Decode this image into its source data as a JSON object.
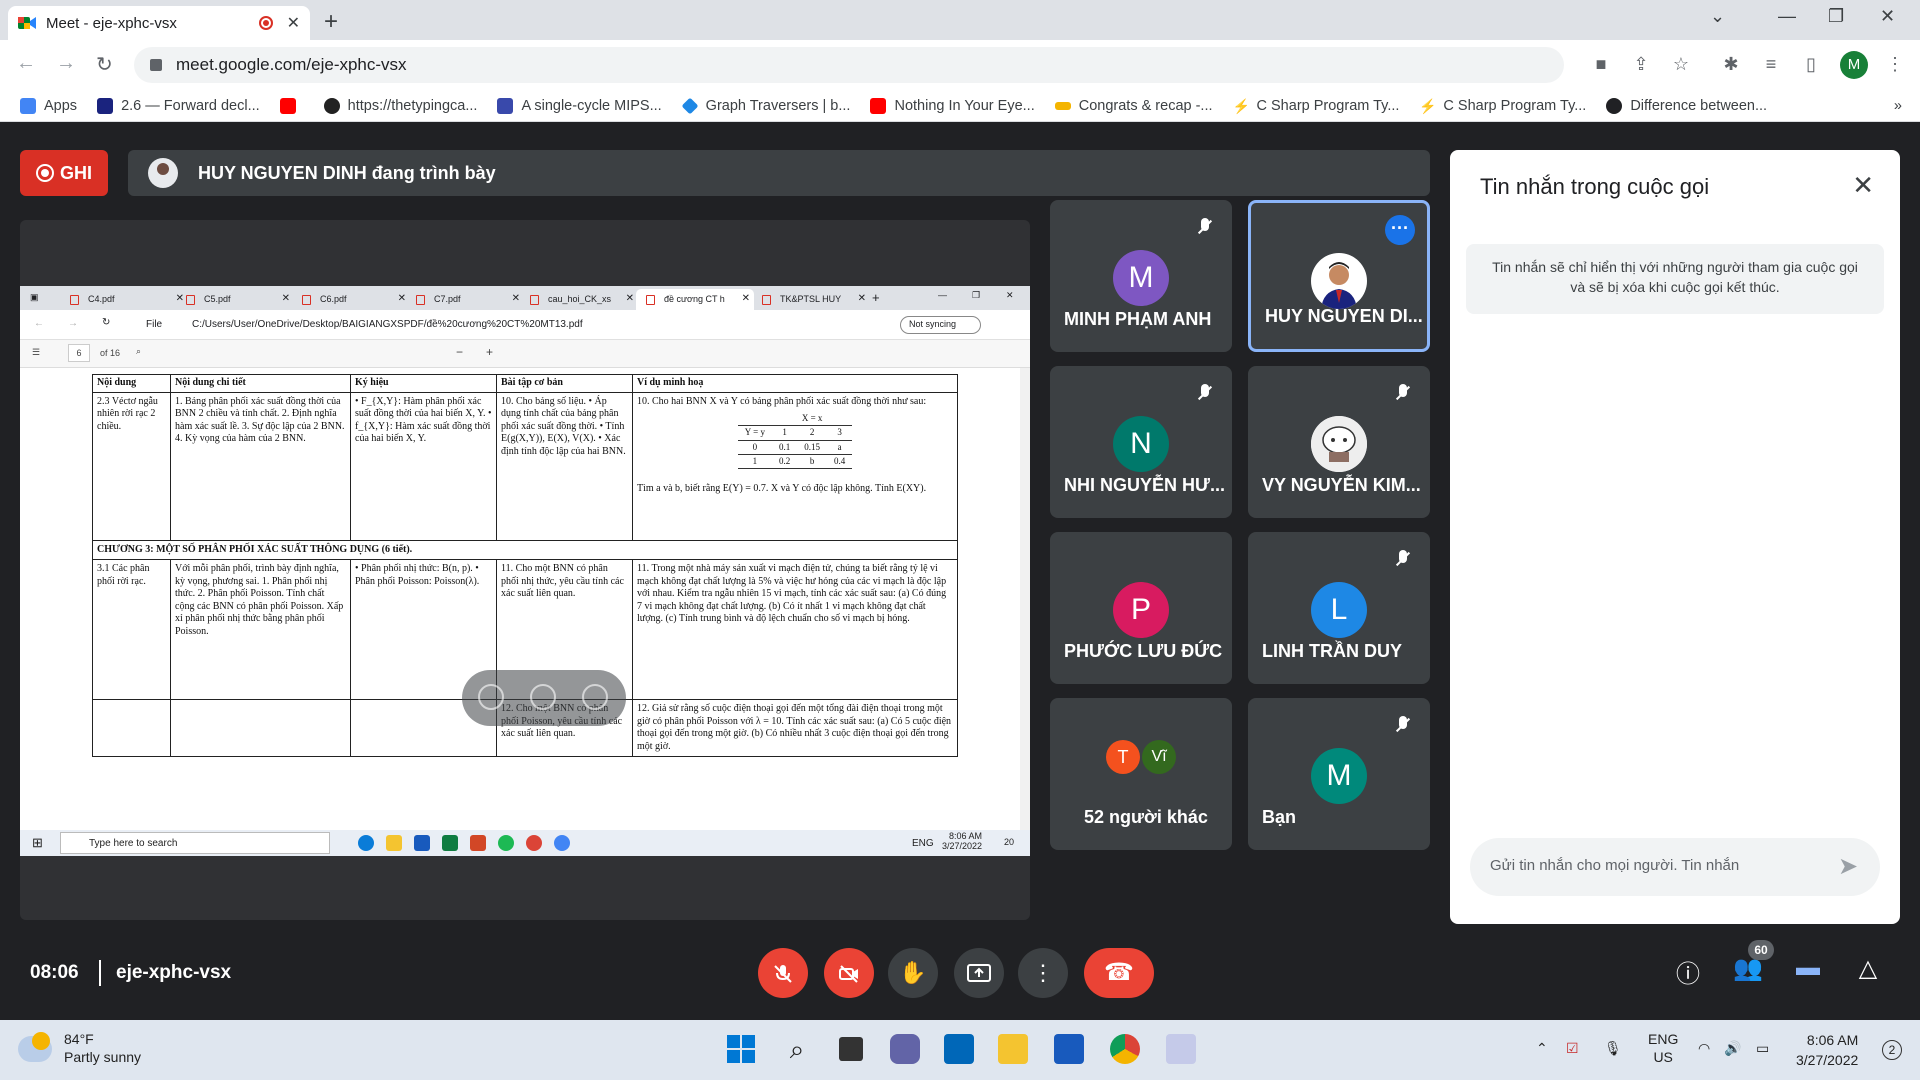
{
  "browser": {
    "tab_title": "Meet - eje-xphc-vsx",
    "url": "meet.google.com/eje-xphc-vsx",
    "profile_letter": "M",
    "bookmarks": [
      {
        "label": "Apps",
        "color": "#4285f4"
      },
      {
        "label": "2.6 — Forward decl...",
        "color": "#1a237e"
      },
      {
        "label": "",
        "color": "#ff0000"
      },
      {
        "label": "https://thetypingca...",
        "color": "#222222"
      },
      {
        "label": "A single-cycle MIPS...",
        "color": "#3949ab"
      },
      {
        "label": "Graph Traversers | b...",
        "color": "#1e88e5"
      },
      {
        "label": "Nothing In Your Eye...",
        "color": "#ff0000"
      },
      {
        "label": "Congrats & recap -...",
        "color": "#f4b400"
      },
      {
        "label": "C Sharp Program Ty...",
        "color": "#333333"
      },
      {
        "label": "C Sharp Program Ty...",
        "color": "#333333"
      },
      {
        "label": "Difference between...",
        "color": "#202124"
      }
    ]
  },
  "meet": {
    "record_label": "GHI",
    "presenting_text": "HUY NGUYEN DINH đang trình bày",
    "participants": [
      {
        "name": "MINH PHẠM ANH",
        "initial": "M",
        "color": "#7e57c2"
      },
      {
        "name": "HUY NGUYEN DI...",
        "initial": "",
        "color": "#ffffff"
      },
      {
        "name": "NHI NGUYỄN HƯ...",
        "initial": "N",
        "color": "#00796b"
      },
      {
        "name": "VY NGUYỄN KIM...",
        "initial": "",
        "color": "#fafafa"
      },
      {
        "name": "PHƯỚC LƯU ĐỨC",
        "initial": "P",
        "color": "#d81b60"
      },
      {
        "name": "LINH TRẦN DUY",
        "initial": "L",
        "color": "#1e88e5"
      },
      {
        "name": "52 người khác",
        "initial": "T",
        "initial2": "Vĩ",
        "color": "#f4511e",
        "color2": "#33691e"
      },
      {
        "name": "Bạn",
        "initial": "M",
        "color": "#00897b"
      }
    ],
    "chat": {
      "title": "Tin nhắn trong cuộc gọi",
      "note": "Tin nhắn sẽ chỉ hiển thị với những người tham gia cuộc gọi và sẽ bị xóa khi cuộc gọi kết thúc.",
      "placeholder": "Gửi tin nhắn cho mọi người. Tin nhắn"
    },
    "time": "08:06",
    "code": "eje-xphc-vsx",
    "participant_count": "60"
  },
  "shared_screen": {
    "tabs": [
      "C4.pdf",
      "C5.pdf",
      "C6.pdf",
      "C7.pdf",
      "cau_hoi_CK_xs",
      "đề cương CT h",
      "TK&PTSL HUY"
    ],
    "file_label": "File",
    "path": "C:/Users/User/OneDrive/Desktop/BAIGIANGXSPDF/đề%20cương%20CT%20MT13.pdf",
    "sync_label": "Not syncing",
    "page_num": "6",
    "page_total": "of 16",
    "table_headers": [
      "Nội dung",
      "Nội dung chi tiết",
      "Ký hiệu",
      "Bài tập cơ bản",
      "Ví dụ minh hoạ"
    ],
    "row1": {
      "c1": "2.3 Véctơ ngẫu nhiên rời rạc 2 chiều.",
      "c2": "1. Bảng phân phối xác suất đồng thời của BNN 2 chiều và tính chất. 2. Định nghĩa hàm xác suất lề. 3. Sự độc lập của 2 BNN. 4. Kỳ vọng của hàm của 2 BNN.",
      "c3": "• F_{X,Y}: Hàm phân phối xác suất đồng thời của hai biến X, Y. • f_{X,Y}: Hàm xác suất đồng thời của hai biến X, Y.",
      "c4": "10. Cho bảng số liệu. • Áp dụng tính chất của bảng phân phối xác suất đồng thời. • Tính E(g(X,Y)), E(X), V(X). • Xác định tính độc lập của hai BNN.",
      "c5": "10. Cho hai BNN X và Y có bảng phân phối xác suất đồng thời như sau:",
      "c5b": "Tìm a và b, biết rằng E(Y) = 0.7. X và Y có độc lập không. Tính E(XY)."
    },
    "mini_table": {
      "header": "X = x",
      "row0": [
        "Y = y",
        "1",
        "2",
        "3"
      ],
      "row1": [
        "0",
        "0.1",
        "0.15",
        "a"
      ],
      "row2": [
        "1",
        "0.2",
        "b",
        "0.4"
      ]
    },
    "chapter": "CHƯƠNG 3: MỘT SỐ PHÂN PHỐI XÁC SUẤT THÔNG DỤNG (6 tiết).",
    "row2": {
      "c1": "3.1 Các phân phối rời rạc.",
      "c2": "Với mỗi phân phối, trình bày định nghĩa, kỳ vọng, phương sai. 1. Phân phối nhị thức. 2. Phân phối Poisson. Tính chất cộng các BNN có phân phối Poisson. Xấp xỉ phân phối nhị thức bằng phân phối Poisson.",
      "c3": "• Phân phối nhị thức: B(n, p). • Phân phối Poisson: Poisson(λ).",
      "c4": "11. Cho một BNN có phân phối nhị thức, yêu cầu tính các xác suất liên quan.",
      "c5": "11. Trong một nhà máy sản xuất vi mạch điện tử, chúng ta biết rằng tỷ lệ vi mạch không đạt chất lượng là 5% và việc hư hỏng của các vi mạch là độc lập với nhau. Kiểm tra ngẫu nhiên 15 vi mạch, tính các xác suất sau: (a) Có đúng 7 vi mạch không đạt chất lượng. (b) Có ít nhất 1 vi mạch không đạt chất lượng. (c) Tính trung bình và độ lệch chuẩn cho số vi mạch bị hỏng.",
      "c4b": "12. Cho một BNN có phân phối Poisson, yêu cầu tính các xác suất liên quan.",
      "c5b": "12. Giả sử rằng số cuộc điện thoại gọi đến một tổng đài điện thoại trong một giờ có phân phối Poisson với λ = 10. Tính các xác suất sau: (a) Có 5 cuộc điện thoại gọi đến trong một giờ. (b) Có nhiều nhất 3 cuộc điện thoại gọi đến trong một giờ."
    },
    "taskbar": {
      "search": "Type here to search",
      "lang": "ENG",
      "time": "8:06 AM",
      "date": "3/27/2022",
      "notif": "20"
    }
  },
  "windows": {
    "temp": "84°F",
    "weather": "Partly sunny",
    "lang1": "ENG",
    "lang2": "US",
    "time": "8:06 AM",
    "date": "3/27/2022",
    "notif": "2"
  }
}
